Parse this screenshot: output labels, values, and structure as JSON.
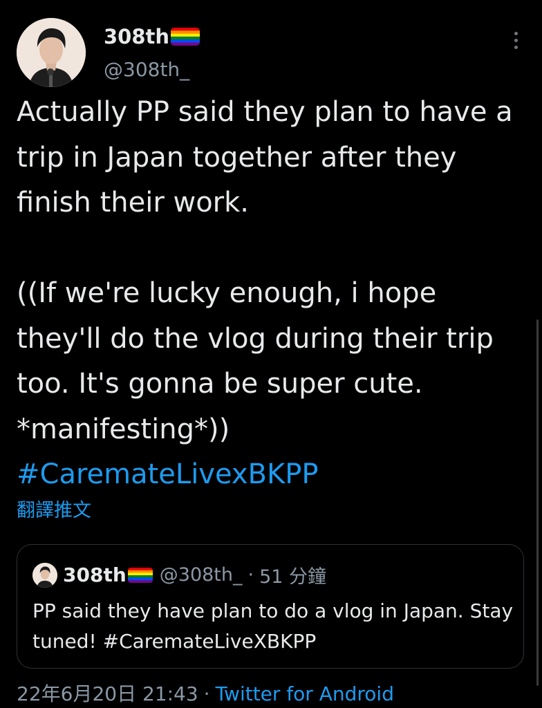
{
  "author": {
    "display_name": "308th",
    "handle": "@308th_",
    "avatar_icon": "profile-photo-icon",
    "badge_icon": "rainbow-flag-icon"
  },
  "tweet": {
    "text_main": "Actually PP said they plan to have a trip in Japan together after they finish their work.\n\n((If we're lucky enough, i hope they'll do the vlog during their trip too. It's gonna be super cute. *manifesting*))\n",
    "hashtag": "#CaremateLivexBKPP",
    "translate_label": "翻譯推文"
  },
  "quoted_tweet": {
    "display_name": "308th",
    "handle": "@308th_",
    "separator": "·",
    "time_ago": "51 分鐘",
    "text_main": "PP said they have plan to do a vlog in Japan. Stay tuned! ",
    "hashtag": "#CaremateLiveXBKPP"
  },
  "footer": {
    "timestamp": "22年6月20日 21:43",
    "separator": "·",
    "source": "Twitter for Android"
  },
  "colors": {
    "background": "#000000",
    "text": "#e7e9ea",
    "secondary": "#8b98a5",
    "link": "#1d9bf0",
    "border": "#2f3336"
  }
}
